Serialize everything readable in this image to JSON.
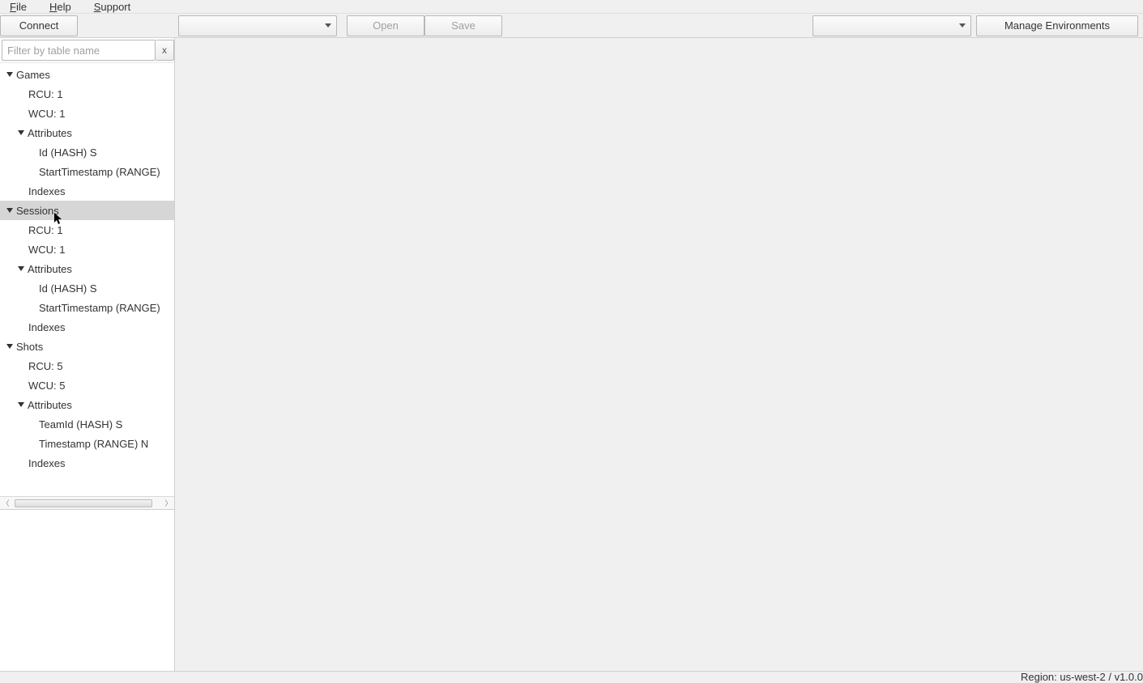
{
  "menu": {
    "file": "File",
    "help": "Help",
    "support": "Support"
  },
  "toolbar": {
    "connect": "Connect",
    "open": "Open",
    "save": "Save",
    "manage": "Manage Environments"
  },
  "filter": {
    "placeholder": "Filter by table name",
    "clear": "x"
  },
  "tree": {
    "tables": [
      {
        "name": "Games",
        "rcu": "RCU: 1",
        "wcu": "WCU: 1",
        "attrs_label": "Attributes",
        "attrs": [
          "Id (HASH) S",
          "StartTimestamp (RANGE)"
        ],
        "indexes": "Indexes",
        "selected": false
      },
      {
        "name": "Sessions",
        "rcu": "RCU: 1",
        "wcu": "WCU: 1",
        "attrs_label": "Attributes",
        "attrs": [
          "Id (HASH) S",
          "StartTimestamp (RANGE)"
        ],
        "indexes": "Indexes",
        "selected": true
      },
      {
        "name": "Shots",
        "rcu": "RCU: 5",
        "wcu": "WCU: 5",
        "attrs_label": "Attributes",
        "attrs": [
          "TeamId (HASH) S",
          "Timestamp (RANGE) N"
        ],
        "indexes": "Indexes",
        "selected": false
      }
    ]
  },
  "status": {
    "text": "Region: us-west-2 / v1.0.0"
  }
}
